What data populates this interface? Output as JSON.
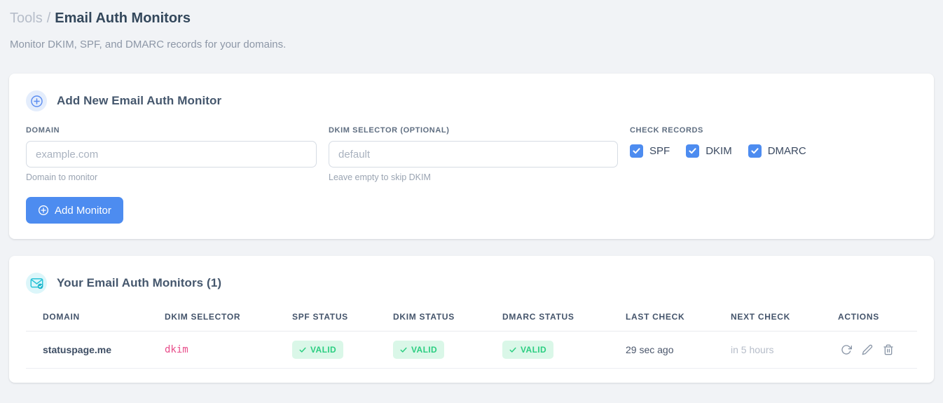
{
  "breadcrumb": {
    "parent": "Tools",
    "separator": "/",
    "current": "Email Auth Monitors"
  },
  "subtitle": "Monitor DKIM, SPF, and DMARC records for your domains.",
  "add_monitor_card": {
    "title": "Add New Email Auth Monitor",
    "fields": {
      "domain": {
        "label": "DOMAIN",
        "value": "",
        "placeholder": "example.com",
        "helper": "Domain to monitor"
      },
      "dkim_selector": {
        "label": "DKIM SELECTOR (OPTIONAL)",
        "value": "",
        "placeholder": "default",
        "helper": "Leave empty to skip DKIM"
      }
    },
    "check_records": {
      "label": "CHECK RECORDS",
      "options": [
        {
          "label": "SPF",
          "checked": true
        },
        {
          "label": "DKIM",
          "checked": true
        },
        {
          "label": "DMARC",
          "checked": true
        }
      ]
    },
    "submit_label": "Add Monitor"
  },
  "monitors_card": {
    "title": "Your Email Auth Monitors (1)",
    "table": {
      "headers": [
        "DOMAIN",
        "DKIM SELECTOR",
        "SPF STATUS",
        "DKIM STATUS",
        "DMARC STATUS",
        "LAST CHECK",
        "NEXT CHECK",
        "ACTIONS"
      ],
      "rows": [
        {
          "domain": "statuspage.me",
          "dkim_selector": "dkim",
          "spf_status": "VALID",
          "dkim_status": "VALID",
          "dmarc_status": "VALID",
          "last_check": "29 sec ago",
          "next_check": "in 5 hours"
        }
      ]
    }
  },
  "colors": {
    "accent_blue": "#4d8cf0",
    "valid_green": "#2bce81",
    "valid_bg": "#daf7e8",
    "code_pink": "#e84d8a",
    "teal_icon": "#29c3d7"
  }
}
